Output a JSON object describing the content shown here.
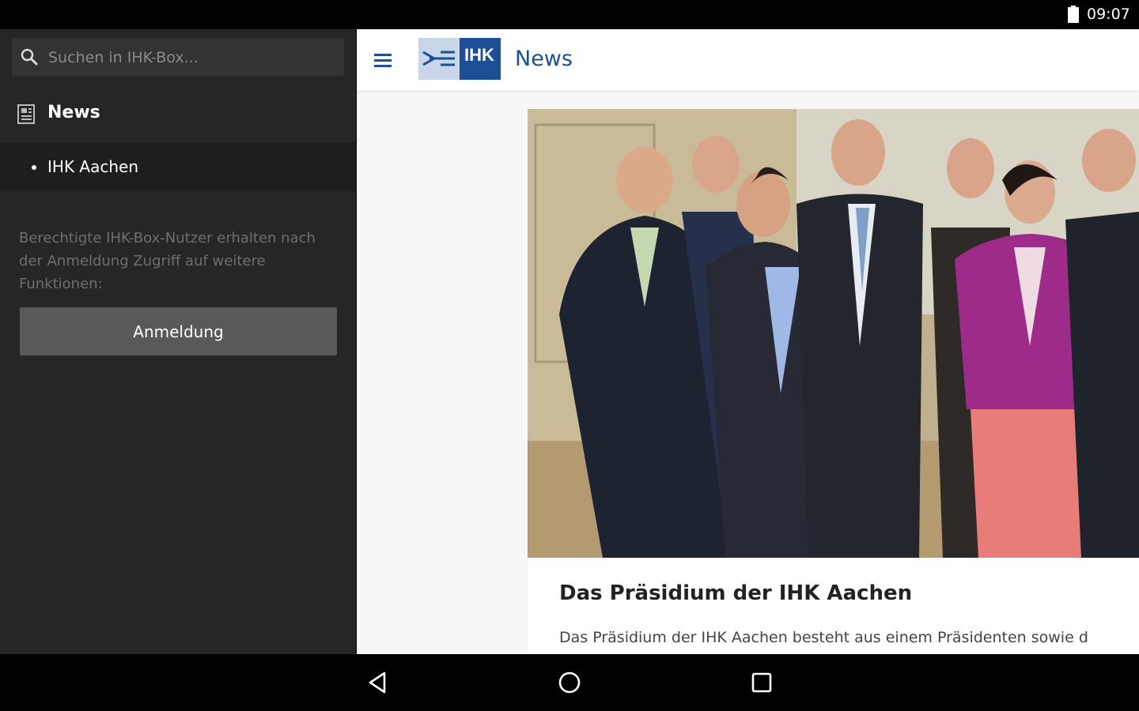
{
  "status_bar": {
    "time": "09:07"
  },
  "drawer": {
    "search_placeholder": "Suchen in IHK-Box...",
    "nav": [
      {
        "label": "News",
        "icon": "newspaper-icon"
      },
      {
        "label": "IHK Aachen",
        "icon": "bullet"
      }
    ],
    "info_text": "Berechtigte IHK-Box-Nutzer erhalten nach der Anmeldung Zugriff auf weitere Funktionen:",
    "login_label": "Anmeldung"
  },
  "toolbar": {
    "logo_text": "IHK",
    "title": "News"
  },
  "article": {
    "title": "Das Präsidium der IHK Aachen",
    "teaser": "Das Präsidium der IHK Aachen besteht aus einem Präsidenten sowie d"
  },
  "colors": {
    "brand_blue": "#1c4f95",
    "drawer_bg": "#262626",
    "drawer_selected": "#1e1e1e",
    "button_bg": "#595959"
  }
}
